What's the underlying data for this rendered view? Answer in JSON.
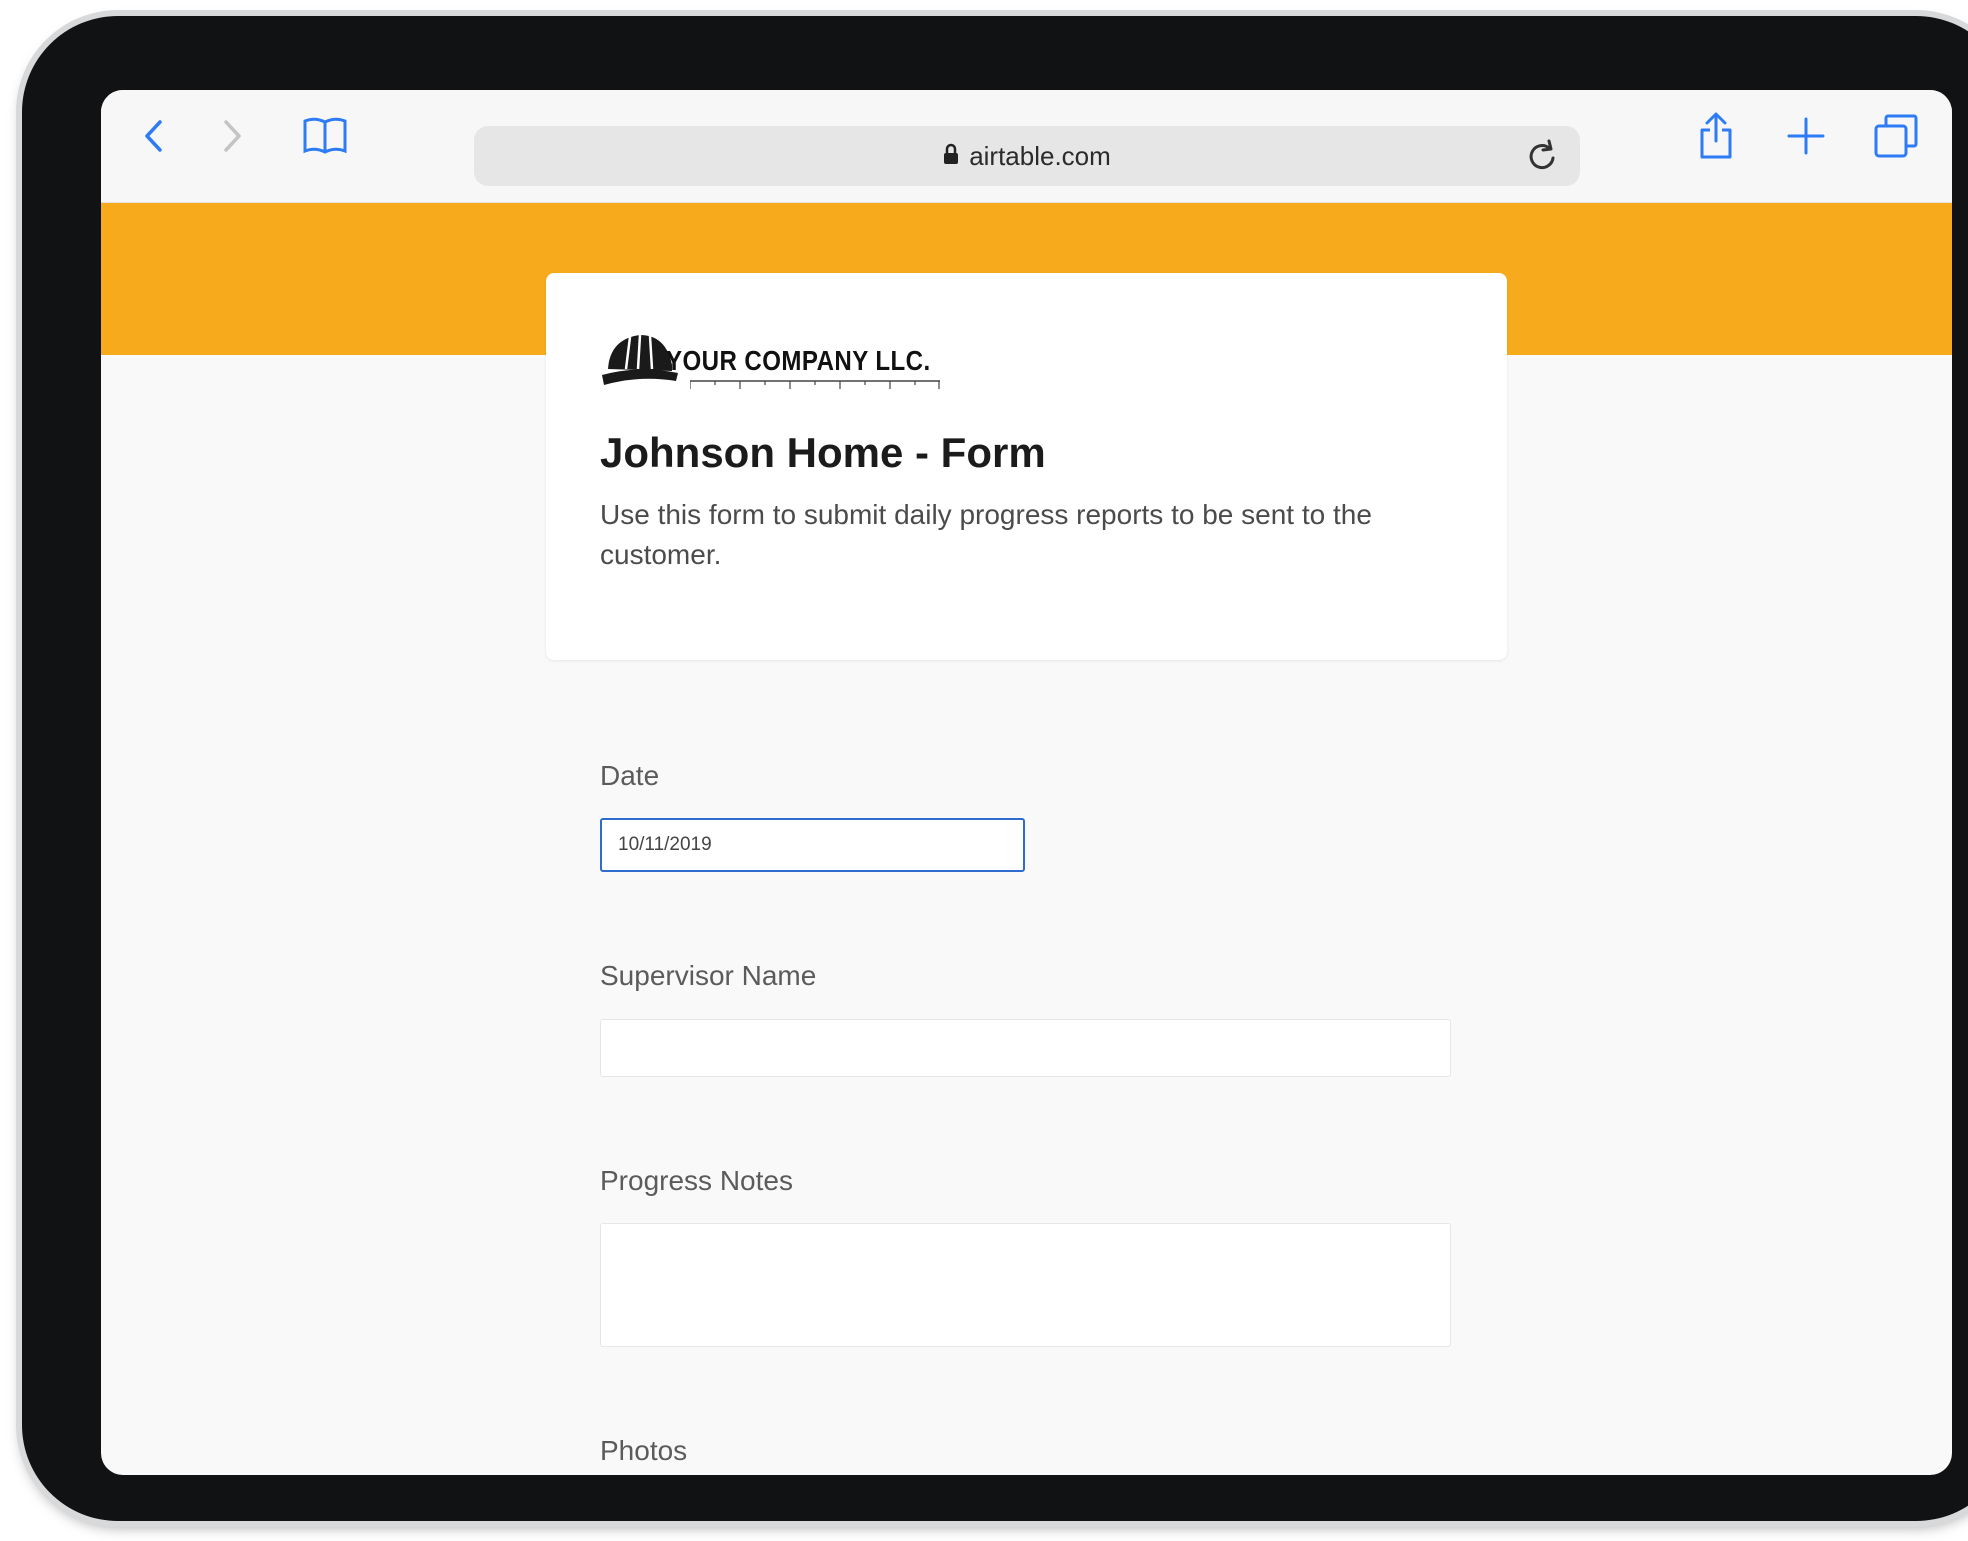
{
  "browser": {
    "url": "airtable.com"
  },
  "form": {
    "company_logo_text": "YOUR COMPANY LLC.",
    "title": "Johnson Home - Form",
    "description": "Use this form to submit daily progress reports to be sent to the customer.",
    "fields": [
      {
        "label": "Date",
        "value": "10/11/2019"
      },
      {
        "label": "Supervisor Name",
        "value": ""
      },
      {
        "label": "Progress Notes",
        "value": ""
      },
      {
        "label": "Photos"
      }
    ]
  },
  "colors": {
    "banner": "#f7aa1c",
    "accent_blue": "#2e7bf6",
    "focus_border": "#2d6bcf"
  }
}
